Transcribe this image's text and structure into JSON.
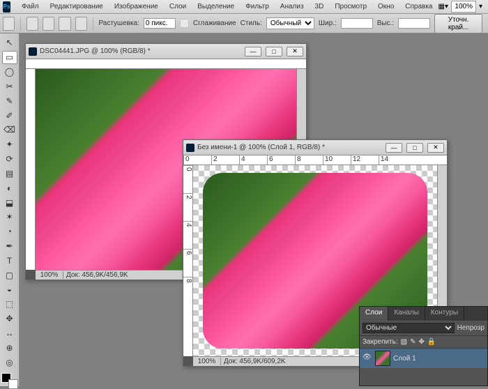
{
  "menubar": {
    "items": [
      "Файл",
      "Редактирование",
      "Изображение",
      "Слои",
      "Выделение",
      "Фильтр",
      "Анализ",
      "3D",
      "Просмотр",
      "Окно",
      "Справка"
    ],
    "zoom": "100%"
  },
  "options": {
    "feather_label": "Растушевка:",
    "feather_value": "0 пикс.",
    "antialias": "Сглаживание",
    "style_label": "Стиль:",
    "style_value": "Обычный",
    "width_label": "Шир.:",
    "height_label": "Выс.:",
    "refine": "Уточн. край..."
  },
  "tools": {
    "list": [
      "↖",
      "▭",
      "◯",
      "✂",
      "✎",
      "✐",
      "⌫",
      "✦",
      "⟳",
      "▤",
      "◐",
      "⬓",
      "✶",
      "◔",
      "✒",
      "T",
      "▢",
      "◒",
      "⬚",
      "✥",
      "↔",
      "⊕",
      "◎"
    ]
  },
  "doc1": {
    "title": "DSC04441.JPG @ 100% (RGB/8) *",
    "zoom": "100%",
    "info": "Док: 456,9K/456,9K"
  },
  "doc2": {
    "title": "Без имени-1 @ 100% (Слой 1, RGB/8) *",
    "zoom": "100%",
    "info": "Док: 456,9K/609,2K",
    "ruler_h": [
      "0",
      "2",
      "4",
      "6",
      "8",
      "10",
      "12",
      "14"
    ],
    "ruler_v": [
      "0",
      "2",
      "4",
      "6",
      "8"
    ]
  },
  "layers": {
    "tabs": [
      "Слои",
      "Каналы",
      "Контуры"
    ],
    "blend": "Обычные",
    "opacity_label": "Непрозр",
    "lock_label": "Закрепить:",
    "layer1": "Слой 1"
  }
}
